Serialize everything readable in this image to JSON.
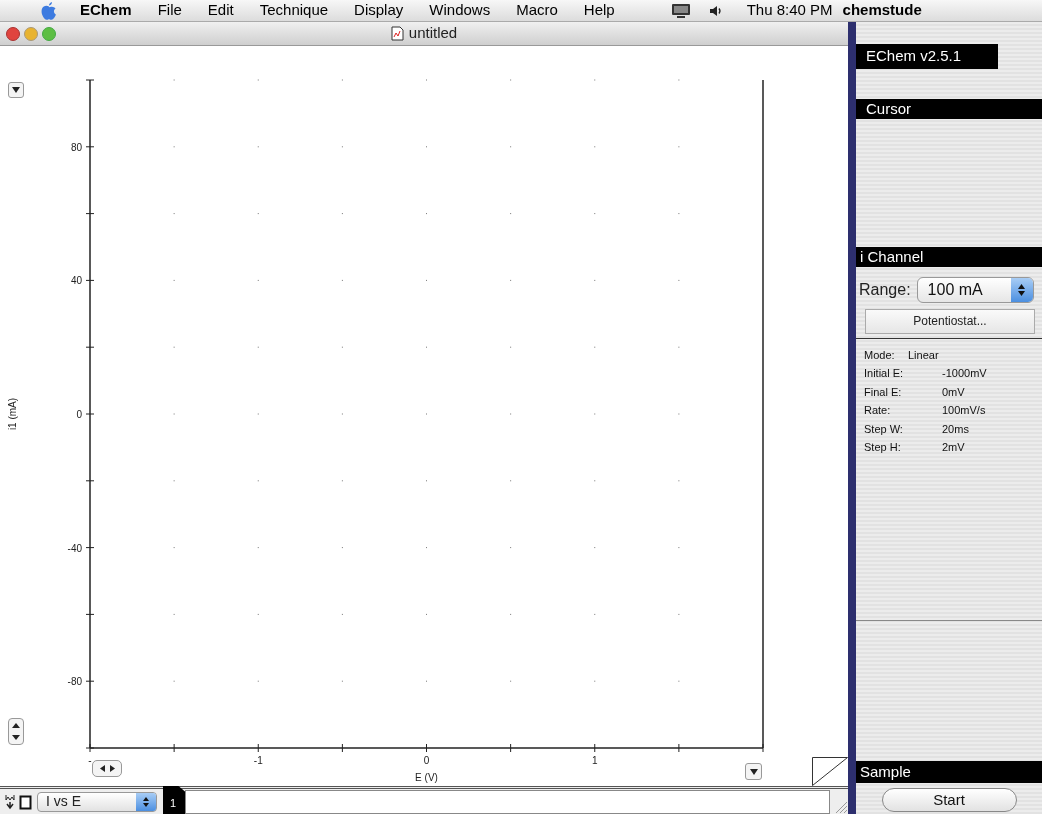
{
  "menu_bar": {
    "items": [
      {
        "label": "EChem",
        "kind": "app"
      },
      {
        "label": "File",
        "kind": "menu"
      },
      {
        "label": "Edit",
        "kind": "menu"
      },
      {
        "label": "Technique",
        "kind": "menu"
      },
      {
        "label": "Display",
        "kind": "menu"
      },
      {
        "label": "Windows",
        "kind": "menu"
      },
      {
        "label": "Macro",
        "kind": "menu"
      },
      {
        "label": "Help",
        "kind": "menu"
      }
    ],
    "clock": "Thu 8:40 PM",
    "user": "chemstude"
  },
  "window": {
    "title": "untitled",
    "chart_data": {
      "type": "line",
      "xlabel": "E (V)",
      "ylabel": "i1 (mA)",
      "xlim": [
        -2,
        2
      ],
      "ylim": [
        -100,
        100
      ],
      "xticks": [
        {
          "value": -2,
          "label": "-"
        },
        -1,
        0,
        1
      ],
      "yticks": [
        -80,
        -40,
        0,
        40,
        80
      ],
      "grid": true
    },
    "view_popup": "I vs E",
    "page_tab": "1"
  },
  "panel": {
    "version": "EChem v2.5.1",
    "cursor_header": "Cursor",
    "channel_header": "i Channel",
    "range_label": "Range:",
    "range_value": "100 mA",
    "potentiostat_button": "Potentiostat...",
    "parameters": [
      {
        "label": "Mode:",
        "value": "Linear",
        "kind": "short"
      },
      {
        "label": "Initial E:",
        "value": "-1000mV",
        "kind": "long"
      },
      {
        "label": "Final E:",
        "value": "0mV",
        "kind": "long"
      },
      {
        "label": "Rate:",
        "value": "100mV/s",
        "kind": "long"
      },
      {
        "label": "Step W:",
        "value": "20ms",
        "kind": "long"
      },
      {
        "label": "Step H:",
        "value": "2mV",
        "kind": "long"
      }
    ],
    "sample_header": "Sample",
    "start_button": "Start"
  }
}
